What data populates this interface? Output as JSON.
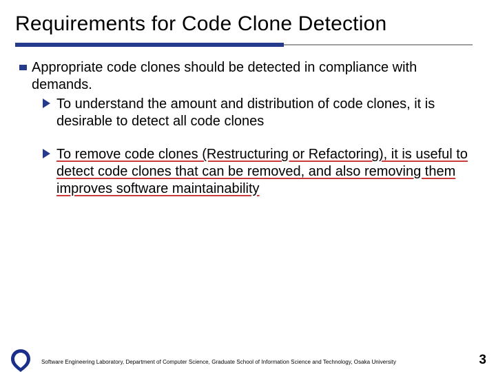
{
  "title": "Requirements for Code Clone Detection",
  "bullets": {
    "l1": "Appropriate code clones should be detected  in compliance with demands.",
    "l2a": "To understand the amount and distribution of code clones, it is desirable to detect all code clones",
    "l2b": "To remove code clones (Restructuring or Refactoring), it is useful to detect code clones that can be removed, and also removing them improves software maintainability"
  },
  "footer": "Software Engineering Laboratory, Department of Computer Science, Graduate School of Information Science and Technology, Osaka University",
  "slide_number": "3"
}
